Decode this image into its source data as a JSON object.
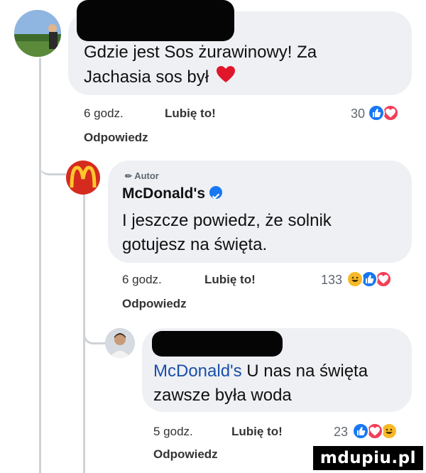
{
  "comments": [
    {
      "text_line1": "Gdzie jest Sos żurawinowy! Za",
      "text_line2": "Jachasia sos był",
      "time": "6 godz.",
      "like": "Lubię to!",
      "reaction_count": "30",
      "reply": "Odpowiedz",
      "reactions": [
        "like-icon",
        "love-icon"
      ]
    },
    {
      "author_badge": "Autor",
      "author": "McDonald's",
      "text_line1": "I jeszcze powiedz, że solnik",
      "text_line2": "gotujesz na święta.",
      "time": "6 godz.",
      "like": "Lubię to!",
      "reaction_count": "133",
      "reply": "Odpowiedz",
      "reactions": [
        "haha-icon",
        "like-icon",
        "love-icon"
      ]
    },
    {
      "mention": "McDonald's",
      "text_line1_rest": " U nas na święta",
      "text_line2": "zawsze była woda",
      "time": "5 godz.",
      "like": "Lubię to!",
      "reaction_count": "23",
      "reply": "Odpowiedz",
      "reactions": [
        "like-icon",
        "love-icon",
        "haha-icon"
      ]
    }
  ],
  "watermark": "mdupiu.pl",
  "colors": {
    "like": "#1877f2",
    "love": "#f33e58",
    "haha": "#f7b928",
    "mention": "#1b4fa8",
    "bubble": "#eef0f3"
  }
}
